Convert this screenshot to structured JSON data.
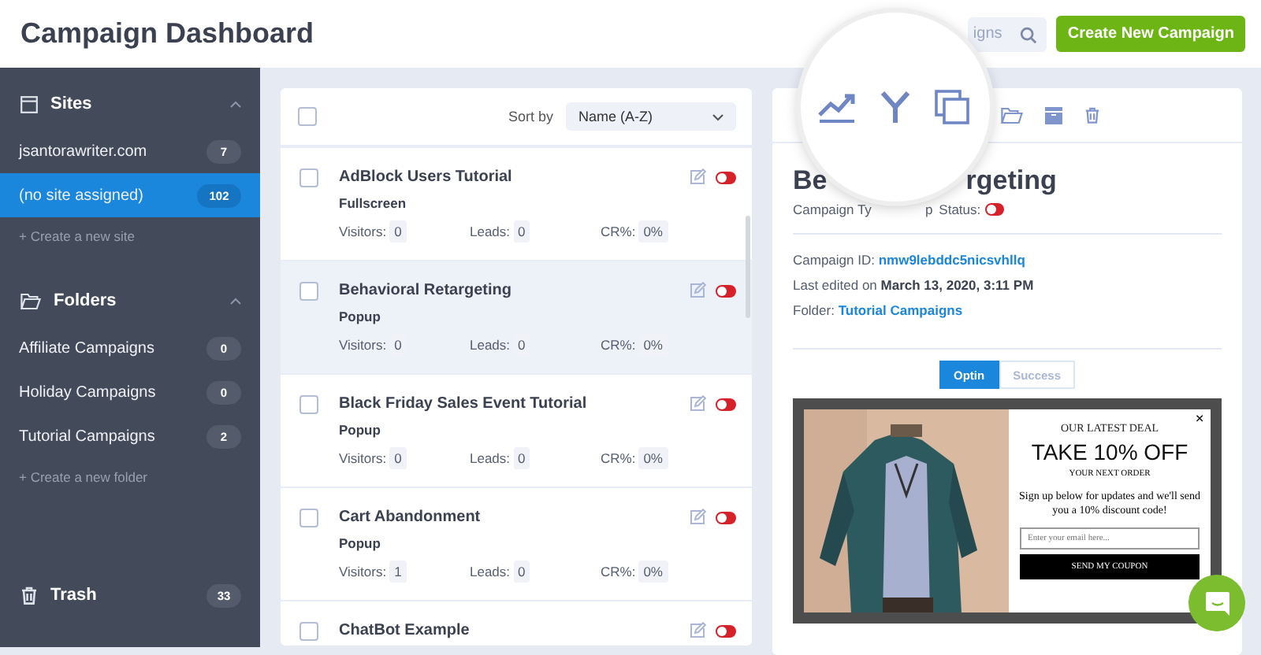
{
  "header": {
    "title": "Campaign Dashboard",
    "search": {
      "placeholder": "igns"
    },
    "create_button": "Create New Campaign"
  },
  "sidebar": {
    "sections": [
      {
        "kind": "sites",
        "title": "Sites",
        "expanded": true,
        "items": [
          {
            "label": "jsantorawriter.com",
            "count": "7",
            "selected": false
          },
          {
            "label": "(no site assigned)",
            "count": "102",
            "selected": true
          }
        ],
        "add_link": "+ Create a new site"
      },
      {
        "kind": "folders",
        "title": "Folders",
        "expanded": true,
        "items": [
          {
            "label": "Affiliate Campaigns",
            "count": "0",
            "selected": false
          },
          {
            "label": "Holiday Campaigns",
            "count": "0",
            "selected": false
          },
          {
            "label": "Tutorial Campaigns",
            "count": "2",
            "selected": false
          }
        ],
        "add_link": "+ Create a new folder"
      },
      {
        "kind": "trash",
        "title": "Trash",
        "count": "33"
      }
    ]
  },
  "list": {
    "select_all_checked": false,
    "sort_label": "Sort by",
    "sort_value": "Name (A-Z)",
    "campaigns": [
      {
        "name": "AdBlock Users Tutorial",
        "type": "Fullscreen",
        "stats": [
          {
            "label": "Visitors:",
            "value": "0"
          },
          {
            "label": "Leads:",
            "value": "0"
          },
          {
            "label": "CR%:",
            "value": "0%"
          }
        ],
        "selected": false,
        "checked": false,
        "on": false
      },
      {
        "name": "Behavioral Retargeting",
        "type": "Popup",
        "stats": [
          {
            "label": "Visitors:",
            "value": "0"
          },
          {
            "label": "Leads:",
            "value": "0"
          },
          {
            "label": "CR%:",
            "value": "0%"
          }
        ],
        "selected": true,
        "checked": false,
        "on": false
      },
      {
        "name": "Black Friday Sales Event Tutorial",
        "type": "Popup",
        "stats": [
          {
            "label": "Visitors:",
            "value": "0"
          },
          {
            "label": "Leads:",
            "value": "0"
          },
          {
            "label": "CR%:",
            "value": "0%"
          }
        ],
        "selected": false,
        "checked": false,
        "on": false
      },
      {
        "name": "Cart Abandonment",
        "type": "Popup",
        "stats": [
          {
            "label": "Visitors:",
            "value": "1"
          },
          {
            "label": "Leads:",
            "value": "0"
          },
          {
            "label": "CR%:",
            "value": "0%"
          }
        ],
        "selected": false,
        "checked": false,
        "on": false
      },
      {
        "name": "ChatBot Example",
        "selected": false,
        "checked": false,
        "on": false
      }
    ]
  },
  "detail": {
    "title_parts": [
      "Be",
      "rgeting"
    ],
    "type_parts": [
      "Campaign Ty",
      "p"
    ],
    "status_label": "Status:",
    "status_on": false,
    "id_label": "Campaign ID:",
    "id": "nmw9lebddc5nicsvhllq",
    "edited_label": "Last edited on",
    "edited": "March 13, 2020, 3:11 PM",
    "folder_label": "Folder:",
    "folder": "Tutorial Campaigns",
    "tabs": [
      {
        "label": "Optin",
        "selected": true
      },
      {
        "label": "Success",
        "selected": false
      }
    ],
    "preview": {
      "kicker": "OUR LATEST DEAL",
      "headline": "TAKE 10% OFF",
      "sub": "YOUR NEXT ORDER",
      "body": "Sign up below for updates and we'll send you a 10% discount code!",
      "email_placeholder": "Enter your email here...",
      "button": "SEND MY COUPON",
      "close": "×"
    }
  }
}
